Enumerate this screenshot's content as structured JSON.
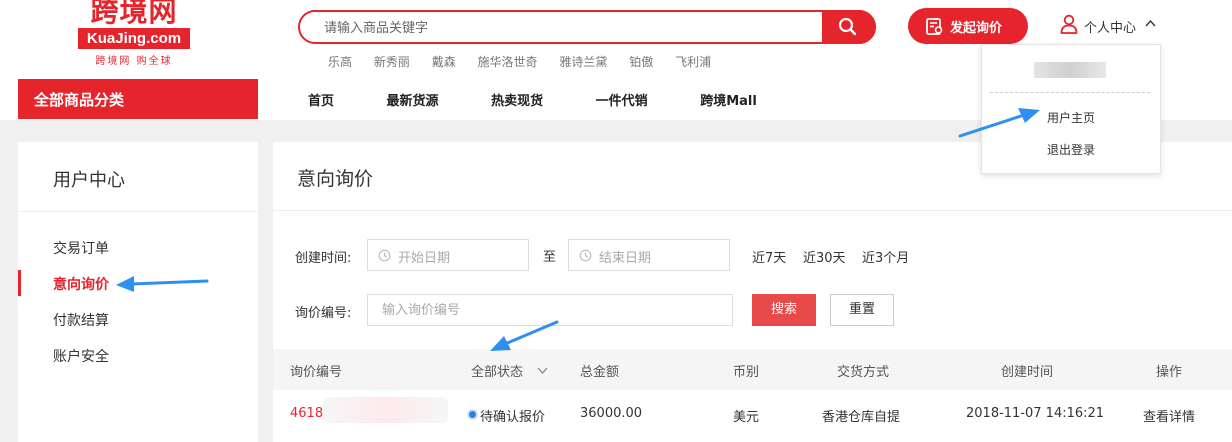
{
  "header": {
    "logo": {
      "cn": "跨境网",
      "en": "KuaJing.com",
      "tagline": "跨境网 购全球"
    },
    "search": {
      "placeholder": "请输入商品关键字"
    },
    "hot_keywords": [
      "乐高",
      "新秀丽",
      "戴森",
      "施华洛世奇",
      "雅诗兰黛",
      "铂傲",
      "飞利浦"
    ],
    "inquiry_button": "发起询价",
    "user_center": "个人中心"
  },
  "category_bar": "全部商品分类",
  "nav": [
    "首页",
    "最新货源",
    "热卖现货",
    "一件代销",
    "跨境Mall"
  ],
  "user_dropdown": {
    "items": [
      "用户主页",
      "退出登录"
    ]
  },
  "sidebar": {
    "title": "用户中心",
    "items": [
      "交易订单",
      "意向询价",
      "付款结算",
      "账户安全"
    ],
    "active_index": 1
  },
  "main": {
    "title": "意向询价",
    "filters": {
      "created_label": "创建时间:",
      "start_placeholder": "开始日期",
      "to": "至",
      "end_placeholder": "结束日期",
      "quick": [
        "近7天",
        "近30天",
        "近3个月"
      ],
      "no_label": "询价编号:",
      "no_placeholder": "输入询价编号",
      "search": "搜索",
      "reset": "重置"
    },
    "table": {
      "headers": [
        "询价编号",
        "全部状态",
        "总金额",
        "币别",
        "交货方式",
        "创建时间",
        "操作"
      ],
      "rows": [
        {
          "no": "4618",
          "status": "待确认报价",
          "amount": "36000.00",
          "currency": "美元",
          "delivery": "香港仓库自提",
          "created": "2018-11-07 14:16:21",
          "action": "查看详情"
        }
      ]
    }
  },
  "colors": {
    "brand": "#e6242c",
    "arrow": "#2f8ff0"
  }
}
